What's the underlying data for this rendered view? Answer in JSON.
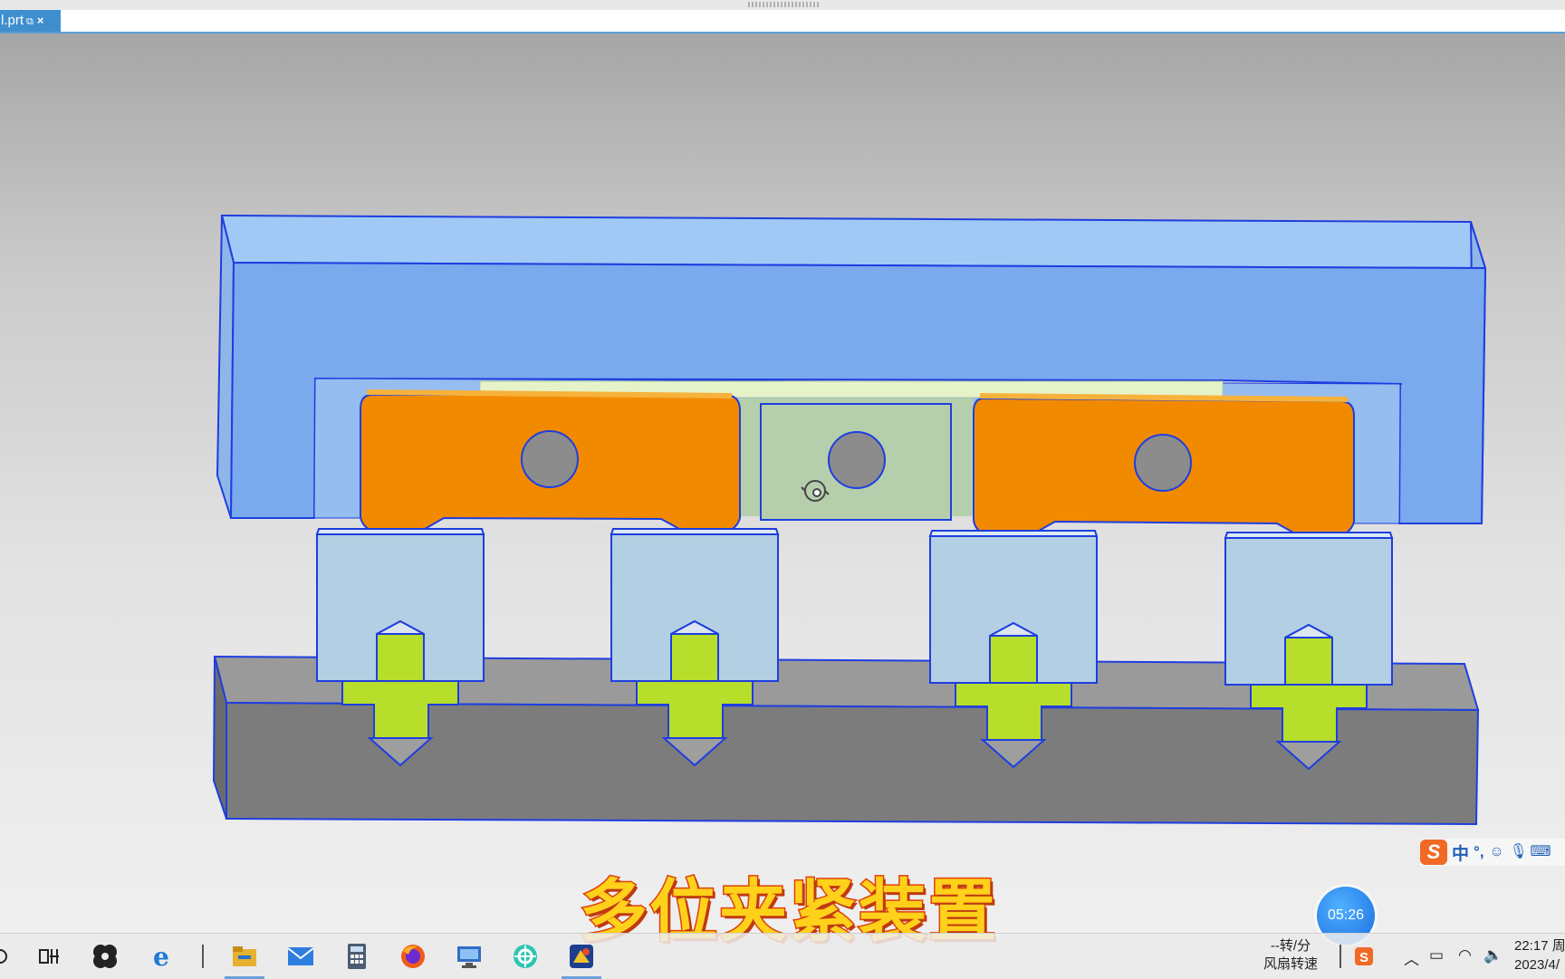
{
  "window": {
    "tab_label": "l.prt",
    "tab_pin_icon": "⧉",
    "tab_close_icon": "×"
  },
  "viewport": {
    "title": "多位夹紧装置"
  },
  "ime_toolbar": {
    "logo": "S",
    "language": "中",
    "punctuation": "°,",
    "icons": [
      "smile-icon",
      "microphone-icon",
      "keyboard-icon"
    ]
  },
  "recording_timer": "05:26",
  "taskbar": {
    "apps": [
      "search",
      "task-view",
      "pinwheel-app",
      "internet-explorer",
      "file-explorer",
      "mail",
      "calculator",
      "firefox",
      "remote-desktop",
      "network-tool",
      "nx-app"
    ],
    "fan": {
      "speed": "--转/分",
      "label": "风扇转速"
    },
    "clock": {
      "time": "22:17 周",
      "date": "2023/4/"
    }
  },
  "colors": {
    "clamp_body": "#7aa9ee",
    "clamp_top": "#a0caf5",
    "arm": "#f28a00",
    "block": "#b3cfe3",
    "base": "#7c7c7c",
    "pin": "#b7de2b",
    "outline": "#1e3ee0"
  }
}
